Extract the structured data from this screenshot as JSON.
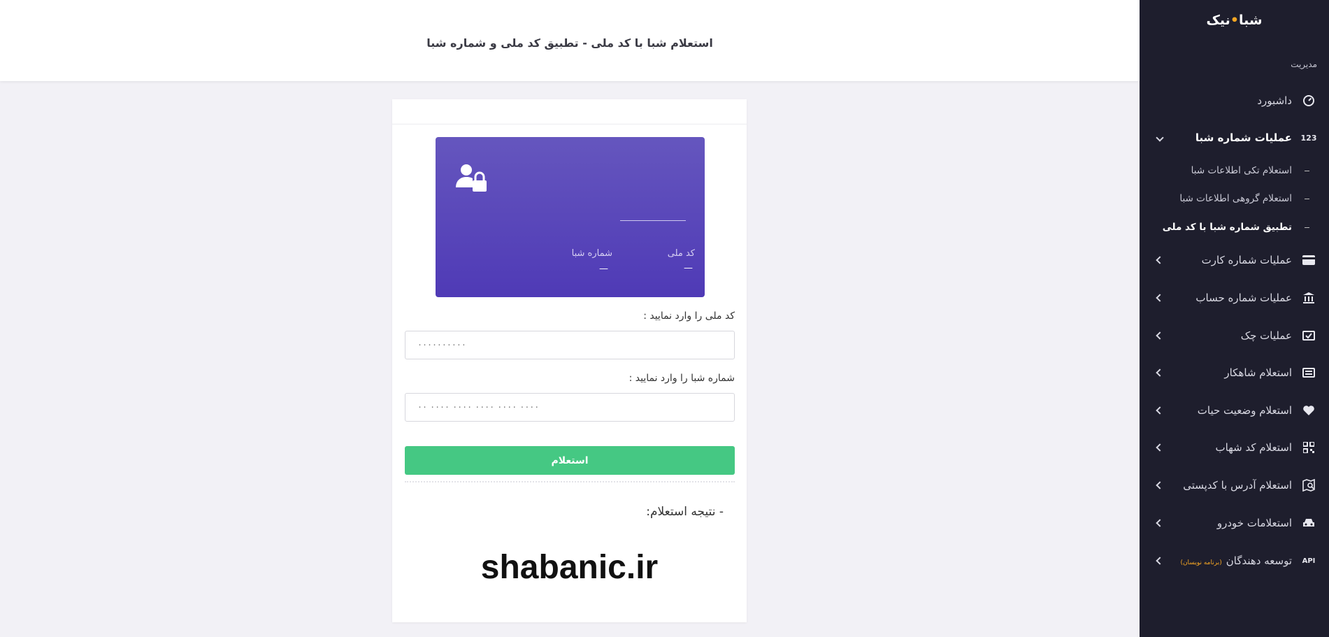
{
  "brand": {
    "before": "شبا",
    "dot": "•",
    "after": "نیک"
  },
  "sidebar": {
    "section_label": "مدیریت",
    "items": [
      {
        "label": "داشبورد",
        "icon": "gauge-icon"
      },
      {
        "label": "عملیات شماره شبا",
        "icon": "123-icon",
        "icon_text": "123"
      },
      {
        "label": "عملیات شماره کارت",
        "icon": "credit-card-icon"
      },
      {
        "label": "عملیات شماره حساب",
        "icon": "bank-icon"
      },
      {
        "label": "عملیات چک",
        "icon": "check-icon"
      },
      {
        "label": "استعلام شاهکار",
        "icon": "id-card-icon"
      },
      {
        "label": "استعلام وضعیت حیات",
        "icon": "heart-icon"
      },
      {
        "label": "استعلام کد شهاب",
        "icon": "qr-code-icon"
      },
      {
        "label": "استعلام آدرس با کدپستی",
        "icon": "map-search-icon"
      },
      {
        "label": "استعلامات خودرو",
        "icon": "car-icon"
      },
      {
        "label": "توسعه دهندگان",
        "badge": "(برنامه نویسان)",
        "icon": "api-icon",
        "icon_text": "API"
      }
    ],
    "sub_items": [
      {
        "label": "استعلام تکی اطلاعات شبا"
      },
      {
        "label": "استعلام گروهی اطلاعات شبا"
      },
      {
        "label": "تطبیق شماره شبا با کد ملی"
      }
    ]
  },
  "header": {
    "title": "استعلام شبا با کد ملی - تطبیق کد ملی و شماره شبا"
  },
  "card": {
    "national_code_label": "کد ملی",
    "national_code_value": "—",
    "sheba_label": "شماره شبا",
    "sheba_value": "—"
  },
  "form": {
    "national_label": "کد ملی را وارد نمایید :",
    "national_placeholder": "۰۰۰۰۰۰۰۰۰۰",
    "sheba_label": "شماره شبا را وارد نمایید :",
    "sheba_placeholder": "۰۰ ۰۰۰۰ ۰۰۰۰ ۰۰۰۰ ۰۰۰۰ ۰۰۰۰",
    "submit_label": "استعلام"
  },
  "result": {
    "title": "- نتیجه استعلام:"
  },
  "watermark": "shabanic.ir",
  "colors": {
    "sidebar": "#1e1e2d",
    "accent": "#45c883",
    "card_top": "#6556be",
    "card_bottom": "#4f3ab6",
    "brand_dot": "#f5a623"
  }
}
